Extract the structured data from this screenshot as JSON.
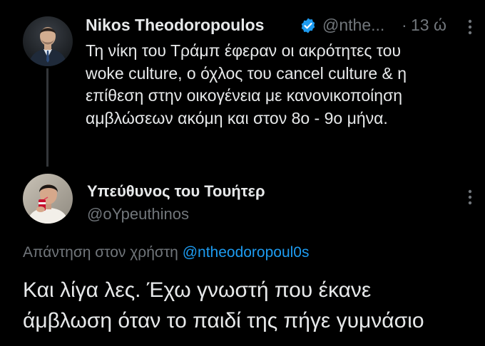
{
  "tweet1": {
    "display_name": "Nikos Theodoropoulos",
    "verified_icon": "verified-badge-icon",
    "handle": "@nthe...",
    "separator": "·",
    "time": "13 ώ",
    "more_icon": "more-options-icon",
    "body_lines": [
      "Τη νίκη του Τράμπ έφεραν οι ακρότητες του",
      "woke culture, ο όχλος του cancel culture & η",
      "επίθεση στην οικογένεια με κανονικοποίηση",
      "αμβλώσεων ακόμη και στον 8ο - 9ο μήνα."
    ]
  },
  "tweet2": {
    "display_name": "Υπεύθυνος του Τουήτερ",
    "handle": "@oYpeuthinos",
    "more_icon": "more-options-icon",
    "reply_label": "Απάντηση στον χρήστη",
    "reply_mention": "@ntheodoropoul0s",
    "body_lines": [
      "Και λίγα λες. Έχω γνωστή που έκανε",
      "άμβλωση όταν το παιδί της πήγε γυμνάσιο"
    ]
  },
  "colors": {
    "background": "#000000",
    "text_primary": "#e7e9ea",
    "text_secondary": "#71767b",
    "accent_link": "#1d9bf0",
    "thread_line": "#333639"
  }
}
